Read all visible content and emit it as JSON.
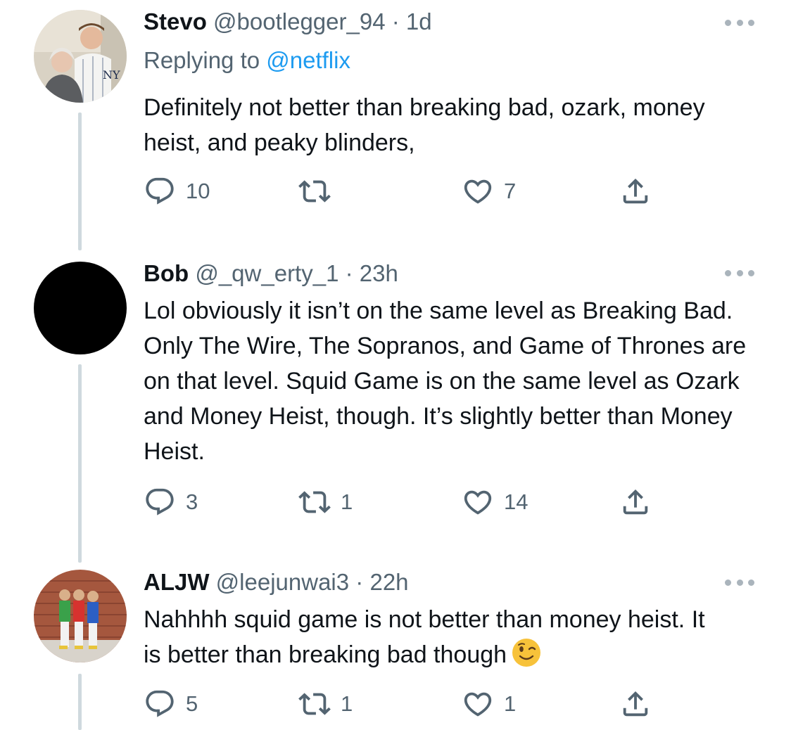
{
  "tweets": [
    {
      "name": "Stevo",
      "handle": "@bootlegger_94",
      "sep": "·",
      "time": "1d",
      "replying_prefix": "Replying to ",
      "replying_to": "@netflix",
      "text": "Definitely not better than breaking bad, ozark, money heist, and peaky blinders,",
      "replies": "10",
      "retweets": "",
      "likes": "7"
    },
    {
      "name": "Bob",
      "handle": "@_qw_erty_1",
      "sep": "·",
      "time": "23h",
      "text": "Lol obviously it isn’t on the same level as Breaking Bad. Only The Wire, The Sopranos, and Game of Thrones are on that level. Squid Game is on the same level as Ozark and Money Heist, though. It’s slightly better than Money Heist.",
      "replies": "3",
      "retweets": "1",
      "likes": "14"
    },
    {
      "name": "ALJW",
      "handle": "@leejunwai3",
      "sep": "·",
      "time": "22h",
      "text": "Nahhhh squid game is not better than money heist. It is better than breaking bad though",
      "emoji": "winking-face",
      "replies": "5",
      "retweets": "1",
      "likes": "1"
    }
  ],
  "icons": {
    "reply": "reply-icon",
    "retweet": "retweet-icon",
    "like": "heart-icon",
    "share": "share-icon",
    "more": "more-icon"
  },
  "colors": {
    "text": "#0f1419",
    "secondary": "#536471",
    "link": "#1d9bf0",
    "thread_line": "#cfd9de"
  }
}
